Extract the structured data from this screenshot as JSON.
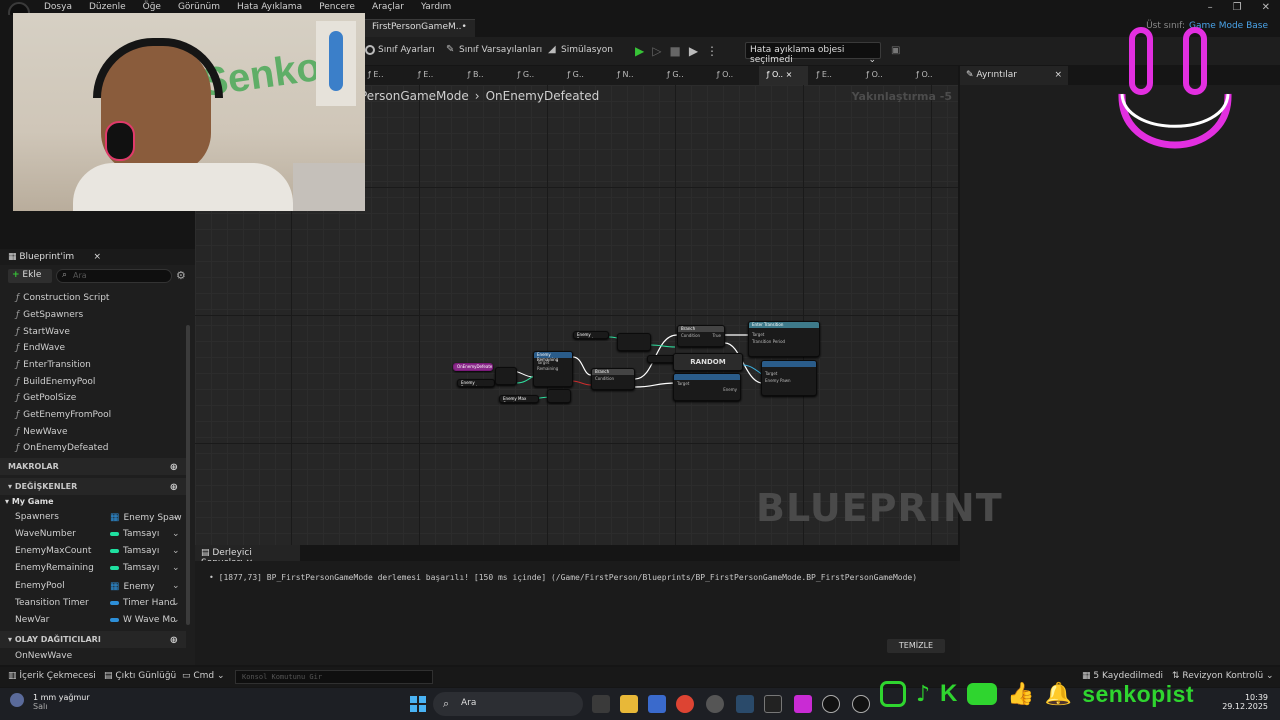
{
  "menu": [
    "Dosya",
    "Düzenle",
    "Öğe",
    "Görünüm",
    "Hata Ayıklama",
    "Pencere",
    "Araçlar",
    "Yardım"
  ],
  "document_tab": "FirstPersonGameM..•",
  "parent_class": {
    "label": "Üst sınıf:",
    "value": "Game Mode Base"
  },
  "toolbar": {
    "class_settings": "Sınıf Ayarları",
    "class_defaults": "Sınıf Varsayılanları",
    "simulation": "Simülasyon",
    "debug_object": "Hata ayıklama objesi seçilmedi"
  },
  "function_tabs": [
    "E..",
    "E..",
    "B..",
    "G..",
    "G..",
    "N..",
    "G..",
    "O..",
    "O..",
    "E..",
    "O..",
    "O.."
  ],
  "details_tab": "Ayrıntılar",
  "breadcrumb": {
    "parent": "PersonGameMode",
    "current": "OnEnemyDefeated"
  },
  "zoom": "Yakınlaştırma -5",
  "watermark": "BLUEPRINT",
  "nodes": {
    "event": "OnEnemyDefeated",
    "random": "RANDOM",
    "enemy_remaining": "Enemy Remaining",
    "target": "Target",
    "remaining": "Remaining",
    "condition": "Condition",
    "true": "True",
    "false": "False",
    "enemy_max_count": "Enemy Max Count",
    "branch": "Branch",
    "enter_transition": "Enter Transition",
    "transition_period": "Transition Period",
    "enemy": "Enemy",
    "enemy_pawn": "Enemy Pawn"
  },
  "left_panel": {
    "title": "Blueprint'im",
    "add": "Ekle",
    "search_placeholder": "Ara",
    "functions": [
      "Construction Script",
      "GetSpawners",
      "StartWave",
      "EndWave",
      "EnterTransition",
      "BuildEnemyPool",
      "GetPoolSize",
      "GetEnemyFromPool",
      "NewWave",
      "OnEnemyDefeated"
    ],
    "macros": "MAKROLAR",
    "variables_head": "DEĞİŞKENLER",
    "category": "My Game",
    "variables": [
      {
        "name": "Spawners",
        "type": "Enemy Spaw",
        "color": "#2d8fd8"
      },
      {
        "name": "WaveNumber",
        "type": "Tamsayı",
        "color": "#1fe0a0"
      },
      {
        "name": "EnemyMaxCount",
        "type": "Tamsayı",
        "color": "#1fe0a0"
      },
      {
        "name": "EnemyRemaining",
        "type": "Tamsayı",
        "color": "#1fe0a0"
      },
      {
        "name": "EnemyPool",
        "type": "Enemy",
        "color": "#2d8fd8"
      },
      {
        "name": "Teansition Timer",
        "type": "Timer Hand",
        "color": "#2d8fd8"
      },
      {
        "name": "NewVar",
        "type": "W Wave Mo",
        "color": "#2d8fd8"
      }
    ],
    "dispatchers_head": "OLAY DAĞITICILARI",
    "dispatchers": [
      "OnNewWave"
    ]
  },
  "compiler": {
    "tab": "Derleyici Sonuçları",
    "message": "[1877,73] BP_FirstPersonGameMode derlemesi başarılı! [150 ms içinde] (/Game/FirstPerson/Blueprints/BP_FirstPersonGameMode.BP_FirstPersonGameMode)",
    "clear": "TEMİZLE"
  },
  "status": {
    "content_drawer": "İçerik Çekmecesi",
    "output_log": "Çıktı Günlüğü",
    "cmd": "Cmd",
    "console_placeholder": "Konsol Komutunu Gir",
    "saved": "5 Kaydedilmedi",
    "revision": "Revizyon Kontrolü"
  },
  "taskbar": {
    "weather": "1 mm yağmur",
    "weather_day": "Salı",
    "search": "Ara",
    "time": "10:39",
    "date": "29.12.2025"
  },
  "overlay": {
    "channel": "senkopist",
    "wall_text": "Senko"
  },
  "colors": {
    "accent": "#4aa3e8",
    "brand_green": "#2fd52f",
    "logo_pink": "#e22fe0"
  }
}
